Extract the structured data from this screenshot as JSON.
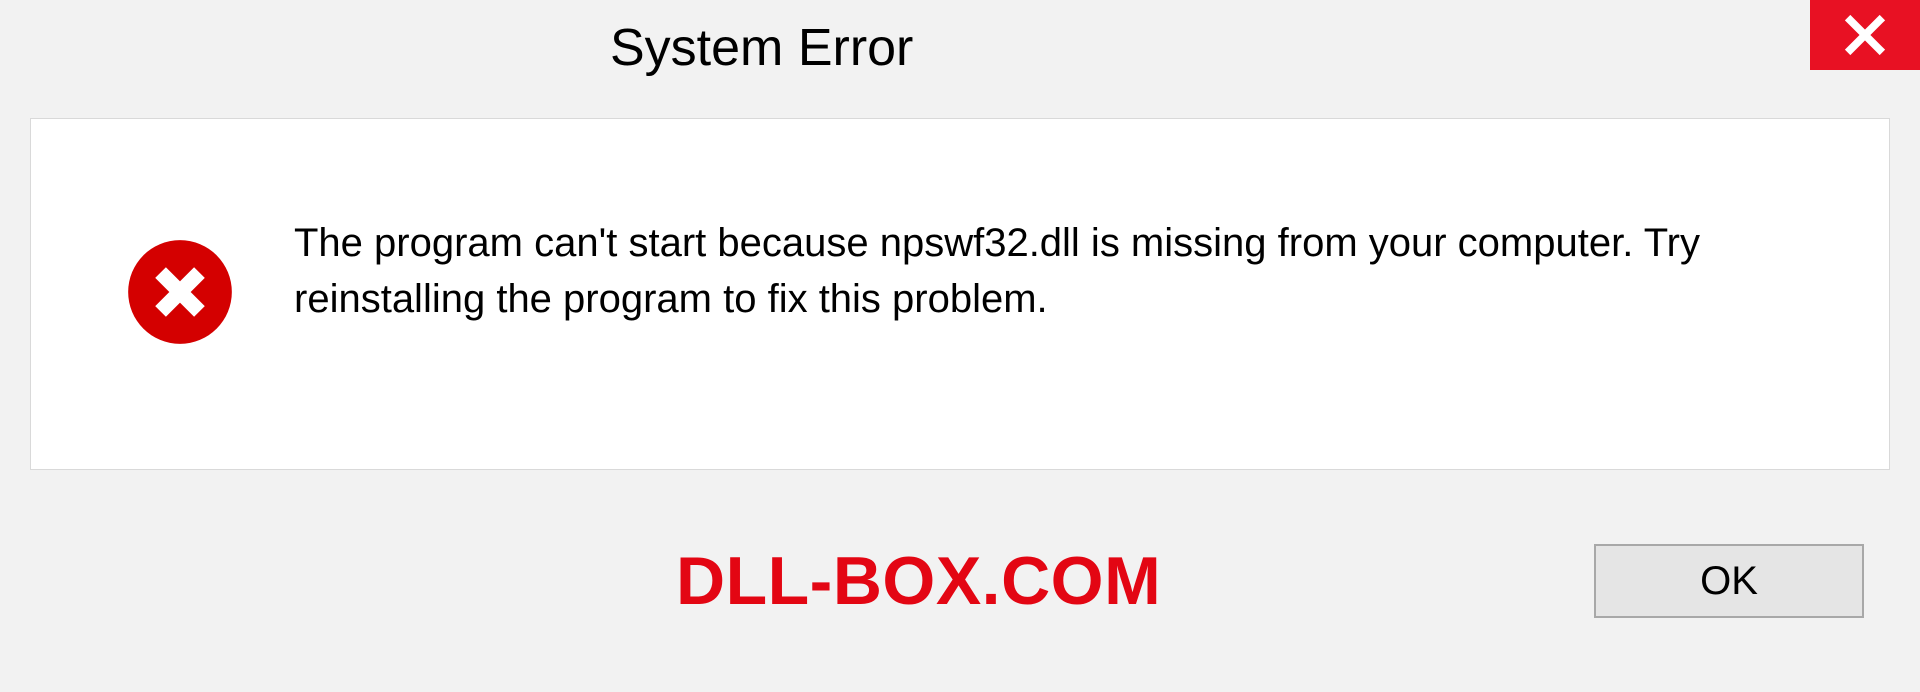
{
  "dialog": {
    "title": "System Error",
    "message": "The program can't start because npswf32.dll is missing from your computer. Try reinstalling the program to fix this problem.",
    "ok_label": "OK"
  },
  "watermark": "DLL-BOX.COM",
  "colors": {
    "close_bg": "#e81123",
    "error_red": "#d40000",
    "watermark_red": "#e30613"
  }
}
